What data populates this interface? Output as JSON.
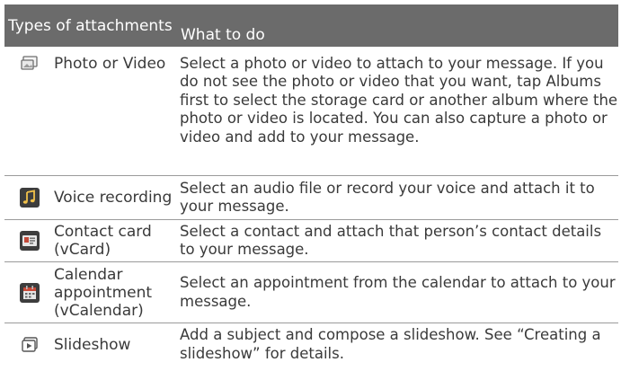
{
  "header": {
    "col1": "Types of attachments",
    "col2": "What to do"
  },
  "rows": [
    {
      "icon": "photo-video-icon",
      "type": "Photo or Video",
      "desc_before": "Select a photo or video to attach to your message. If you do not see the photo or video that you want, tap ",
      "desc_bold": "Albums",
      "desc_after": " first to select the storage card or another album where the photo or video is located. You can also capture a photo or video and add to your message."
    },
    {
      "icon": "music-note-icon",
      "type": "Voice recording",
      "desc": "Select an audio file or record your voice and attach it to your message."
    },
    {
      "icon": "contact-card-icon",
      "type": "Contact card (vCard)",
      "desc": "Select a contact and attach that person’s contact details to your message."
    },
    {
      "icon": "calendar-icon",
      "type": "Calendar appointment (vCalendar)",
      "desc": "Select an appointment from the calendar to attach to your message."
    },
    {
      "icon": "slideshow-icon",
      "type": "Slideshow",
      "desc": "Add a subject and compose a slideshow. See “Creating a slideshow” for details."
    }
  ]
}
